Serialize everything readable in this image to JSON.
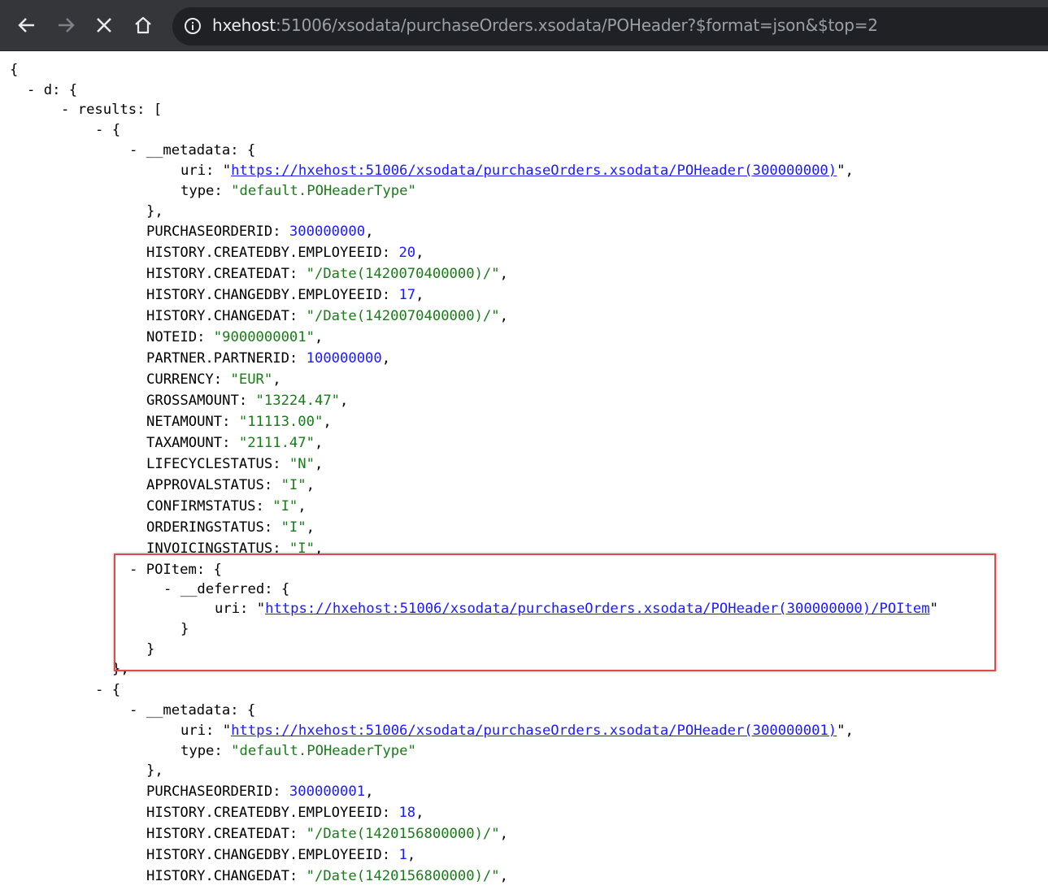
{
  "browser": {
    "url_host": "hxehost",
    "url_rest": ":51006/xsodata/purchaseOrders.xsodata/POHeader?$format=json&$top=2"
  },
  "json": {
    "open_brace": "{",
    "d_key": "d",
    "results_key": "results",
    "records": [
      {
        "metadata_key": "__metadata",
        "uri_key": "uri",
        "uri": "https://hxehost:51006/xsodata/purchaseOrders.xsodata/POHeader(300000000)",
        "type_key": "type",
        "type": "default.POHeaderType",
        "fields": [
          {
            "key": "PURCHASEORDERID",
            "value": "300000000",
            "kind": "number"
          },
          {
            "key": "HISTORY.CREATEDBY.EMPLOYEEID",
            "value": "20",
            "kind": "number"
          },
          {
            "key": "HISTORY.CREATEDAT",
            "value": "\"/Date(1420070400000)/\"",
            "kind": "string"
          },
          {
            "key": "HISTORY.CHANGEDBY.EMPLOYEEID",
            "value": "17",
            "kind": "number"
          },
          {
            "key": "HISTORY.CHANGEDAT",
            "value": "\"/Date(1420070400000)/\"",
            "kind": "string"
          },
          {
            "key": "NOTEID",
            "value": "\"9000000001\"",
            "kind": "string"
          },
          {
            "key": "PARTNER.PARTNERID",
            "value": "100000000",
            "kind": "number"
          },
          {
            "key": "CURRENCY",
            "value": "\"EUR\"",
            "kind": "string"
          },
          {
            "key": "GROSSAMOUNT",
            "value": "\"13224.47\"",
            "kind": "string"
          },
          {
            "key": "NETAMOUNT",
            "value": "\"11113.00\"",
            "kind": "string"
          },
          {
            "key": "TAXAMOUNT",
            "value": "\"2111.47\"",
            "kind": "string"
          },
          {
            "key": "LIFECYCLESTATUS",
            "value": "\"N\"",
            "kind": "string"
          },
          {
            "key": "APPROVALSTATUS",
            "value": "\"I\"",
            "kind": "string"
          },
          {
            "key": "CONFIRMSTATUS",
            "value": "\"I\"",
            "kind": "string"
          },
          {
            "key": "ORDERINGSTATUS",
            "value": "\"I\"",
            "kind": "string"
          },
          {
            "key": "INVOICINGSTATUS",
            "value": "\"I\"",
            "kind": "string"
          }
        ],
        "poitem_key": "POItem",
        "deferred_key": "__deferred",
        "deferred_uri_key": "uri",
        "deferred_uri": "https://hxehost:51006/xsodata/purchaseOrders.xsodata/POHeader(300000000)/POItem"
      },
      {
        "metadata_key": "__metadata",
        "uri_key": "uri",
        "uri": "https://hxehost:51006/xsodata/purchaseOrders.xsodata/POHeader(300000001)",
        "type_key": "type",
        "type": "default.POHeaderType",
        "fields": [
          {
            "key": "PURCHASEORDERID",
            "value": "300000001",
            "kind": "number"
          },
          {
            "key": "HISTORY.CREATEDBY.EMPLOYEEID",
            "value": "18",
            "kind": "number"
          },
          {
            "key": "HISTORY.CREATEDAT",
            "value": "\"/Date(1420156800000)/\"",
            "kind": "string"
          },
          {
            "key": "HISTORY.CHANGEDBY.EMPLOYEEID",
            "value": "1",
            "kind": "number"
          },
          {
            "key": "HISTORY.CHANGEDAT",
            "value": "\"/Date(1420156800000)/\"",
            "kind": "string"
          }
        ]
      }
    ]
  },
  "colors": {
    "toolbar_bg": "#35363a",
    "omnibox_bg": "#202124",
    "string_green": "#1a7a1a",
    "number_blue": "#1a1aff",
    "highlight_red": "#e0484e"
  }
}
